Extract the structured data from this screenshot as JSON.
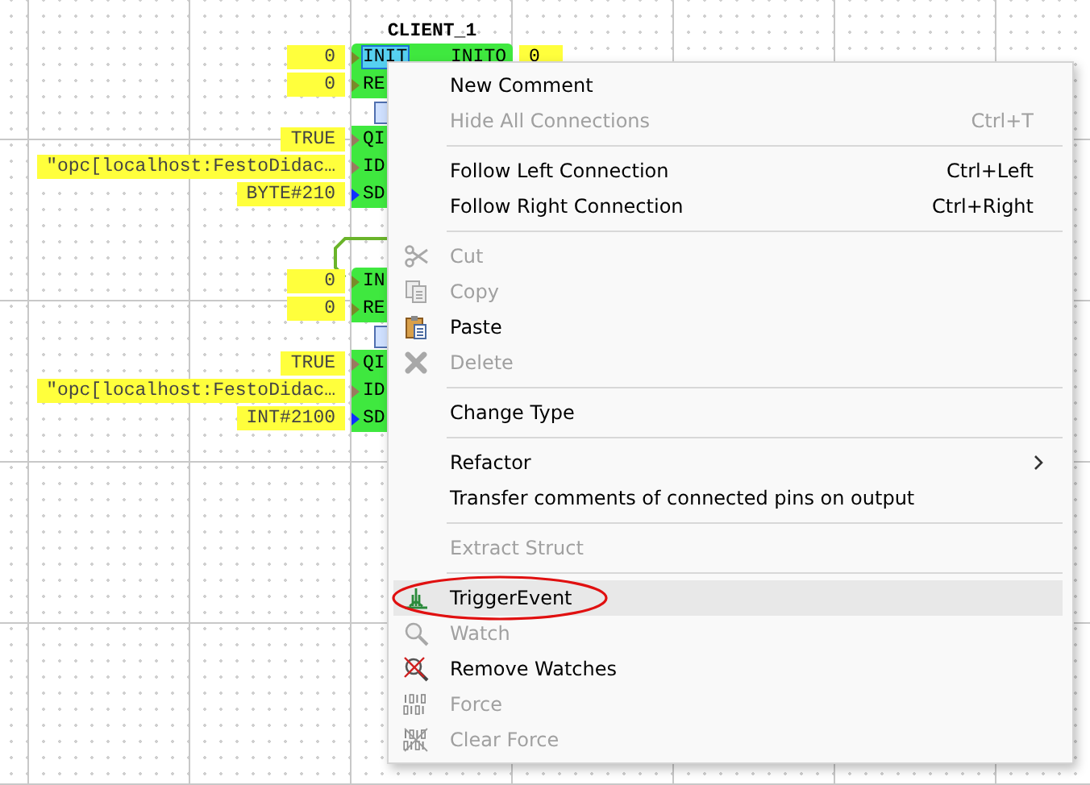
{
  "blocks": [
    {
      "title": "CLIENT_1",
      "rows": [
        {
          "kind": "event",
          "value": "0",
          "pin": "INIT",
          "focused": true,
          "output_pin": "INITO",
          "output_value": "0"
        },
        {
          "kind": "event",
          "value": "0",
          "pin": "RE"
        },
        {
          "kind": "socket"
        },
        {
          "kind": "data",
          "value": "TRUE",
          "pin": "QI"
        },
        {
          "kind": "data",
          "value": "\"opc[localhost:FestoDidac…",
          "pin": "ID"
        },
        {
          "kind": "adapter",
          "value": "BYTE#210",
          "pin": "SD"
        }
      ]
    },
    {
      "rows": [
        {
          "kind": "event",
          "value": "0",
          "pin": "IN",
          "focused": false
        },
        {
          "kind": "event",
          "value": "0",
          "pin": "RE"
        },
        {
          "kind": "socket"
        },
        {
          "kind": "data",
          "value": "TRUE",
          "pin": "QI"
        },
        {
          "kind": "data",
          "value": "\"opc[localhost:FestoDidac…",
          "pin": "ID"
        },
        {
          "kind": "adapter",
          "value": "INT#2100",
          "pin": "SD"
        }
      ]
    }
  ],
  "context_menu": {
    "items": [
      {
        "kind": "item",
        "label": "New Comment",
        "disabled": false,
        "selected": false
      },
      {
        "kind": "item",
        "label": "Hide All Connections",
        "shortcut": "Ctrl+T",
        "disabled": true,
        "selected": false
      },
      {
        "kind": "separator"
      },
      {
        "kind": "item",
        "label": "Follow Left Connection",
        "shortcut": "Ctrl+Left",
        "disabled": false,
        "selected": false
      },
      {
        "kind": "item",
        "label": "Follow Right Connection",
        "shortcut": "Ctrl+Right",
        "disabled": false,
        "selected": false
      },
      {
        "kind": "separator"
      },
      {
        "kind": "item",
        "label": "Cut",
        "disabled": true,
        "selected": false
      },
      {
        "kind": "item",
        "label": "Copy",
        "disabled": true,
        "selected": false
      },
      {
        "kind": "item",
        "label": "Paste",
        "disabled": false,
        "selected": false
      },
      {
        "kind": "item",
        "label": "Delete",
        "disabled": true,
        "selected": false
      },
      {
        "kind": "separator"
      },
      {
        "kind": "item",
        "label": "Change Type",
        "disabled": false,
        "selected": false
      },
      {
        "kind": "separator"
      },
      {
        "kind": "item",
        "label": "Refactor",
        "submenu": true,
        "disabled": false,
        "selected": false
      },
      {
        "kind": "item",
        "label": "Transfer comments of connected pins on output",
        "disabled": false,
        "selected": false
      },
      {
        "kind": "separator"
      },
      {
        "kind": "item",
        "label": "Extract Struct",
        "disabled": true,
        "selected": false
      },
      {
        "kind": "separator"
      },
      {
        "kind": "item",
        "label": "TriggerEvent",
        "disabled": false,
        "selected": true,
        "circled": true
      },
      {
        "kind": "item",
        "label": "Watch",
        "disabled": true,
        "selected": false
      },
      {
        "kind": "item",
        "label": "Remove Watches",
        "disabled": false,
        "selected": false
      },
      {
        "kind": "item",
        "label": "Force",
        "disabled": true,
        "selected": false
      },
      {
        "kind": "item",
        "label": "Clear Force",
        "disabled": true,
        "selected": false
      }
    ]
  }
}
